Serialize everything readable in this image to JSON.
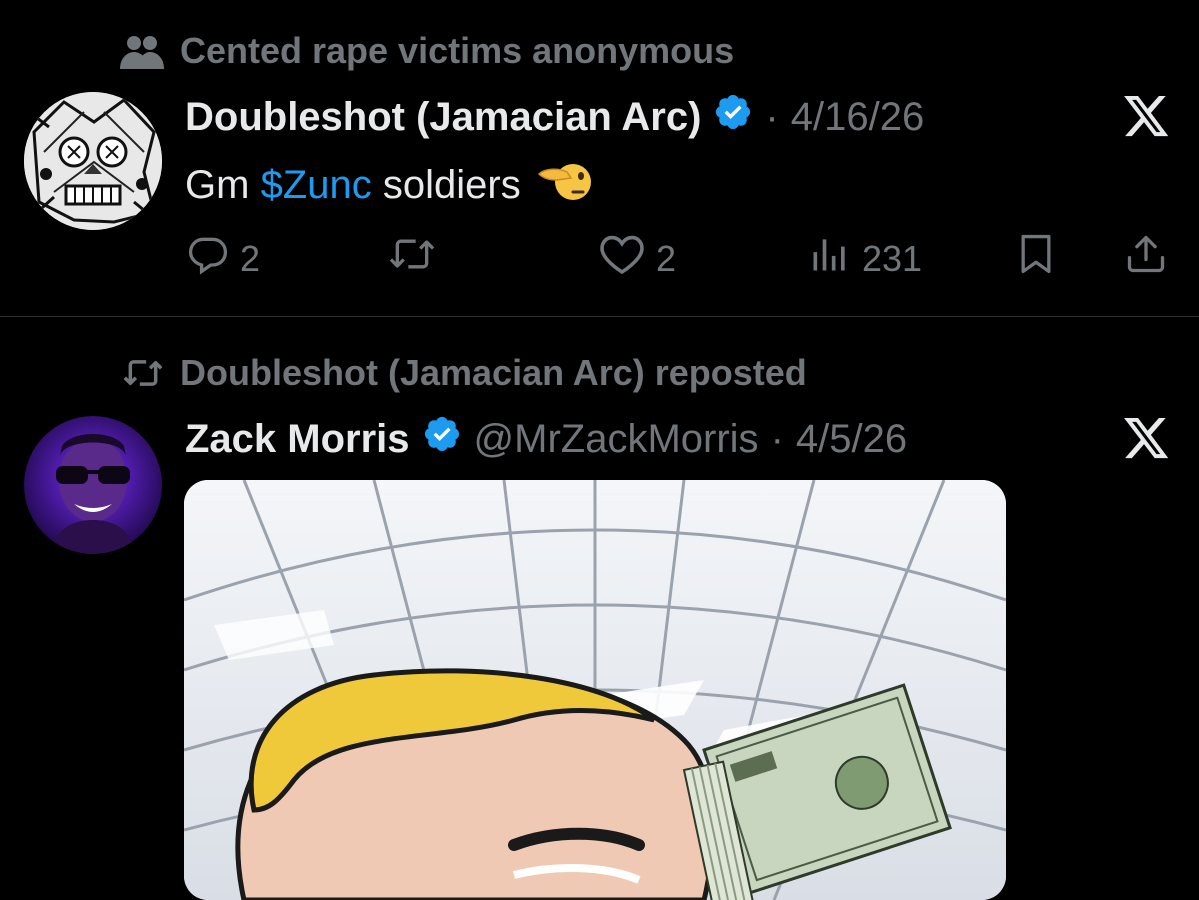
{
  "post1": {
    "context_label": "Cented rape victims anonymous",
    "author_name": "Doubleshot (Jamacian Arc)",
    "date": "4/16/26",
    "text_before": "Gm",
    "cashtag": "$Zunc",
    "text_after": "soldiers",
    "replies": "2",
    "likes": "2",
    "views": "231"
  },
  "post2": {
    "context_label": "Doubleshot (Jamacian Arc) reposted",
    "author_name": "Zack Morris",
    "handle": "@MrZackMorris",
    "date": "4/5/26"
  },
  "icons": {
    "community": "community-icon",
    "verified": "verified-badge-icon",
    "x_logo": "x-logo-icon",
    "reply": "reply-icon",
    "repost": "repost-icon",
    "like": "heart-icon",
    "views": "views-icon",
    "bookmark": "bookmark-icon",
    "share": "share-icon"
  },
  "colors": {
    "background": "#000000",
    "text": "#e7e9ea",
    "muted": "#71767b",
    "accent": "#1d9bf0"
  }
}
